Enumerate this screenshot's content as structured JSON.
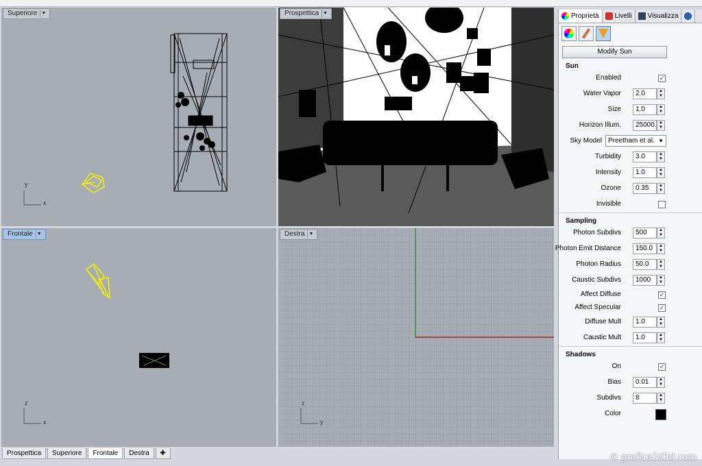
{
  "viewports": {
    "top": {
      "label": "Superiore",
      "axis_y": "y",
      "axis_x": "x"
    },
    "perspective": {
      "label": "Prospettica"
    },
    "front": {
      "label": "Frontale",
      "axis_y": "z",
      "axis_x": "x"
    },
    "right": {
      "label": "Destra",
      "axis_y": "z",
      "axis_x": "y"
    }
  },
  "bottom_tabs": [
    {
      "label": "Prospettica"
    },
    {
      "label": "Superiore"
    },
    {
      "label": "Frontale",
      "active": true
    },
    {
      "label": "Destra"
    }
  ],
  "panel": {
    "tabs": [
      "Proprietà",
      "Livelli",
      "Visualizza"
    ],
    "modify_button": "Modify Sun",
    "sun": {
      "title": "Sun",
      "enabled": {
        "label": "Enabled",
        "checked": true
      },
      "water_vapor": {
        "label": "Water Vapor",
        "value": "2.0"
      },
      "size": {
        "label": "Size",
        "value": "1.0"
      },
      "horizon": {
        "label": "Horizon Illum.",
        "value": "25000.0"
      },
      "sky_model": {
        "label": "Sky Model",
        "value": "Preetham et al."
      },
      "turbidity": {
        "label": "Turbidity",
        "value": "3.0"
      },
      "intensity": {
        "label": "Intensity",
        "value": "1.0"
      },
      "ozone": {
        "label": "Ozone",
        "value": "0.35"
      },
      "invisible": {
        "label": "Invisible",
        "checked": false
      }
    },
    "sampling": {
      "title": "Sampling",
      "photon_subdivs": {
        "label": "Photon Subdivs",
        "value": "500"
      },
      "photon_emit": {
        "label": "Photon Emit Distance",
        "value": "150.0"
      },
      "photon_radius": {
        "label": "Photon Radius",
        "value": "50.0"
      },
      "caustic_subdivs": {
        "label": "Caustic Subdivs",
        "value": "1000"
      },
      "affect_diffuse": {
        "label": "Affect Diffuse",
        "checked": true
      },
      "affect_specular": {
        "label": "Affect Specular",
        "checked": true
      },
      "diffuse_mult": {
        "label": "Diffuse Mult",
        "value": "1.0"
      },
      "caustic_mult": {
        "label": "Caustic Mult",
        "value": "1.0"
      }
    },
    "shadows": {
      "title": "Shadows",
      "on": {
        "label": "On",
        "checked": true
      },
      "bias": {
        "label": "Bias",
        "value": "0.01"
      },
      "subdivs": {
        "label": "Subdivs",
        "value": "8"
      },
      "color": {
        "label": "Color",
        "value": "#000000"
      }
    }
  },
  "watermark": "© grafica2d3d.com"
}
